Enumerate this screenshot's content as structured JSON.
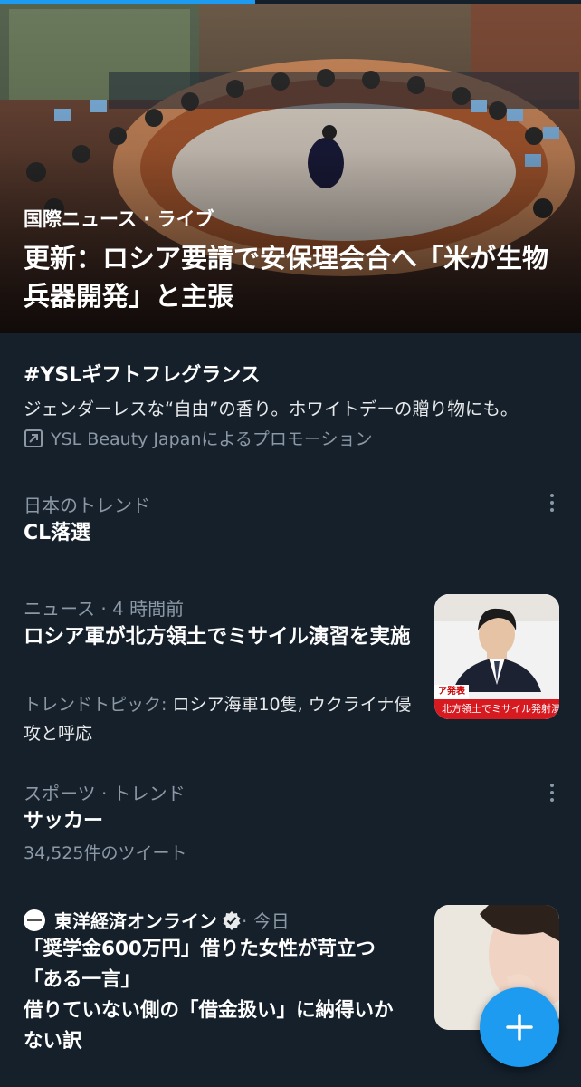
{
  "loading_bar": {
    "progress": 0.44,
    "color": "#1d9bf0"
  },
  "hero": {
    "eyebrow": "国際ニュース · ライブ",
    "title": "更新：ロシア要請で安保理会合へ「米が生物兵器開発」と主張",
    "image": "un-security-council-chamber-photo"
  },
  "promo": {
    "title": "#YSLギフトフレグランス",
    "description": "ジェンダーレスな“自由”の香り。ホワイトデーの贈り物にも。",
    "promoted_by": "YSL Beauty Japanによるプロモーション",
    "icon": "promoted-arrow-icon"
  },
  "trend_japan": {
    "meta": "日本のトレンド",
    "title": "CL落選"
  },
  "news_item": {
    "meta": "ニュース · 4 時間前",
    "title": "ロシア軍が北方領土でミサイル演習を実施",
    "topic_label": "トレンドトピック: ",
    "topic_value": "ロシア海軍10隻, ウクライナ侵攻と呼応",
    "thumbnail_caption_top": "ア発表",
    "thumbnail_caption": "北方領土でミサイル発射演"
  },
  "sports_trend": {
    "meta": "スポーツ · トレンド",
    "title": "サッカー",
    "tweet_count": "34,525件のツイート"
  },
  "article": {
    "source": "東洋経済オンライン",
    "verified": true,
    "time": " · 今日",
    "title_lines": [
      "「奨学金600万円」借りた女性が苛立つ",
      "「ある一言」",
      "借りていない側の「借金扱い」に納得いか",
      "ない訳"
    ]
  },
  "fab": {
    "icon": "plus-icon",
    "color": "#1d9bf0"
  },
  "colors": {
    "background": "#15202b",
    "secondary_text": "#8b98a5",
    "accent": "#1d9bf0"
  }
}
